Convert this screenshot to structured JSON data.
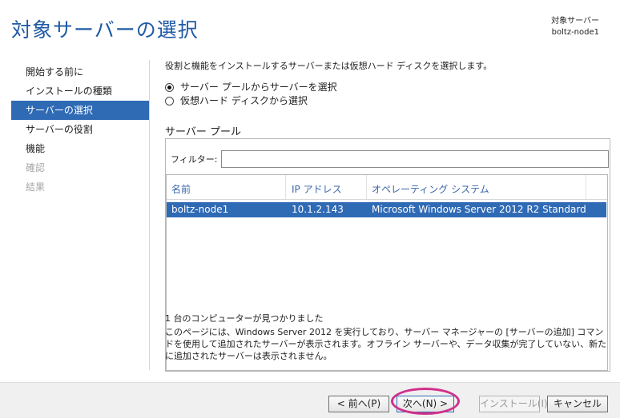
{
  "header": {
    "title": "対象サーバーの選択",
    "target_label": "対象サーバー",
    "target_value": "boltz-node1"
  },
  "sidebar": {
    "items": [
      {
        "label": "開始する前に",
        "state": "normal"
      },
      {
        "label": "インストールの種類",
        "state": "normal"
      },
      {
        "label": "サーバーの選択",
        "state": "selected"
      },
      {
        "label": "サーバーの役割",
        "state": "normal"
      },
      {
        "label": "機能",
        "state": "normal"
      },
      {
        "label": "確認",
        "state": "disabled"
      },
      {
        "label": "結果",
        "state": "disabled"
      }
    ]
  },
  "main": {
    "description": "役割と機能をインストールするサーバーまたは仮想ハード ディスクを選択します。",
    "radio_pool": "サーバー プールからサーバーを選択",
    "radio_vhd": "仮想ハード ディスクから選択",
    "pool_title": "サーバー プール",
    "filter_label": "フィルター:",
    "filter_value": "",
    "columns": [
      "名前",
      "IP アドレス",
      "オペレーティング システム"
    ],
    "rows": [
      [
        "boltz-node1",
        "10.1.2.143",
        "Microsoft Windows Server 2012 R2 Standard"
      ]
    ],
    "found_text": "1 台のコンピューターが見つかりました",
    "note": "このページには、Windows Server 2012 を実行しており、サーバー マネージャーの [サーバーの追加] コマンドを使用して追加されたサーバーが表示されます。オフライン サーバーや、データ収集が完了していない、新たに追加されたサーバーは表示されません。"
  },
  "footer": {
    "prev": "< 前へ(P)",
    "next": "次へ(N) >",
    "install": "インストール(I)",
    "cancel": "キャンセル"
  },
  "colors": {
    "accent": "#2f6ab5",
    "title": "#1f5aa6",
    "annotation_ring": "#d1308c"
  }
}
